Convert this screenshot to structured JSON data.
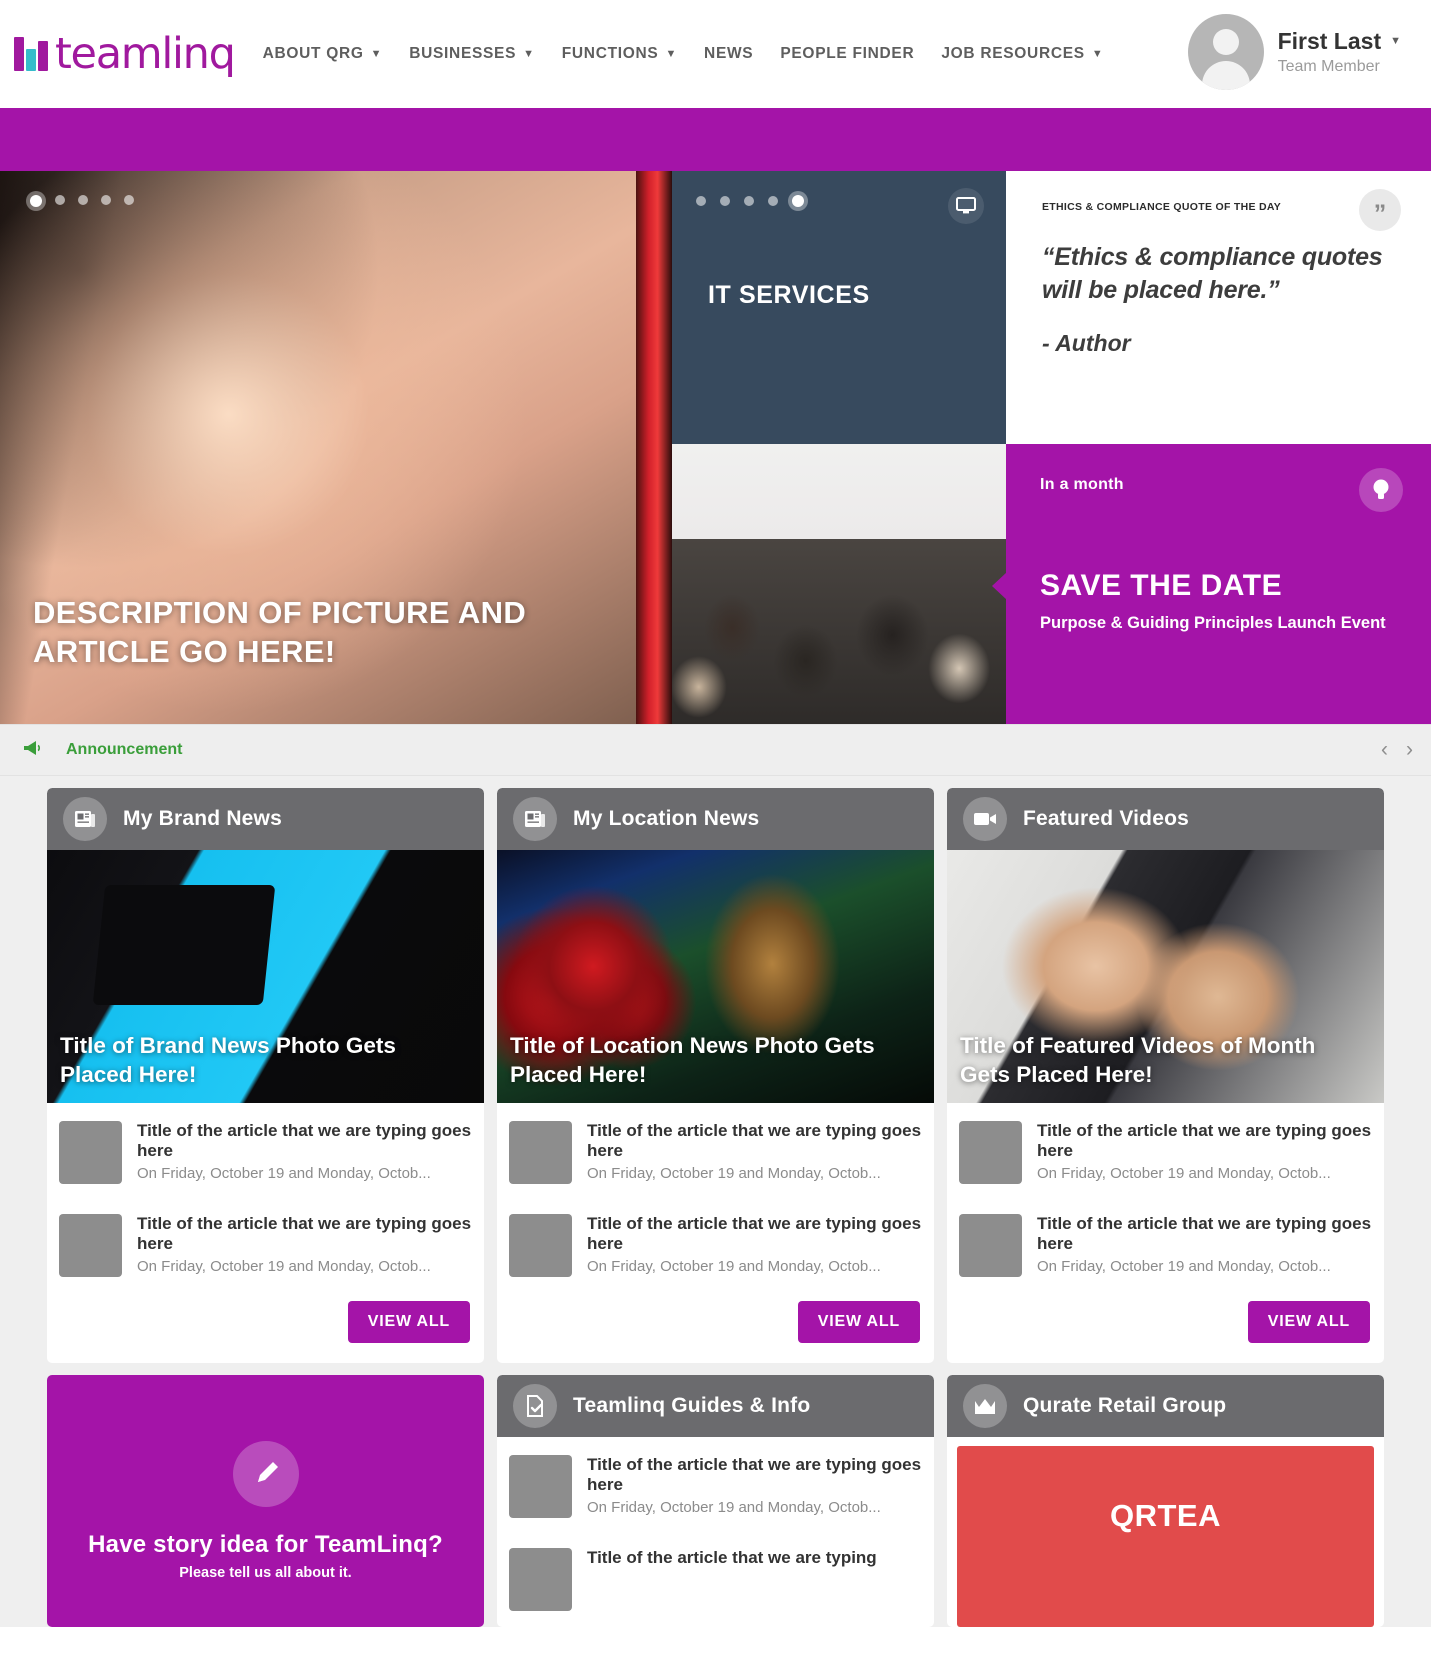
{
  "header": {
    "logo_text": "teamlinq",
    "nav": [
      {
        "label": "ABOUT QRG",
        "has_dropdown": true
      },
      {
        "label": "BUSINESSES",
        "has_dropdown": true
      },
      {
        "label": "FUNCTIONS",
        "has_dropdown": true
      },
      {
        "label": "NEWS",
        "has_dropdown": false
      },
      {
        "label": "PEOPLE FINDER",
        "has_dropdown": false
      },
      {
        "label": "JOB RESOURCES",
        "has_dropdown": true
      }
    ],
    "user": {
      "name": "First Last",
      "role": "Team Member",
      "caret": "⌵"
    }
  },
  "hero": {
    "main": {
      "caption": "DESCRIPTION OF PICTURE AND ARTICLE GO HERE!",
      "dots_total": 5,
      "dot_active": 1
    },
    "it_panel": {
      "title": "IT SERVICES",
      "dots_total": 5,
      "dot_active": 5,
      "icon": "monitor-icon"
    },
    "quote": {
      "kicker": "ETHICS & COMPLIANCE QUOTE OF THE DAY",
      "badge_glyph": "”",
      "text": "“Ethics & compliance quotes will be placed here.”",
      "author": "- Author"
    },
    "save_the_date": {
      "when": "In a month",
      "title": "SAVE THE DATE",
      "subtitle": "Purpose & Guiding Principles Launch Event",
      "icon": "lightbulb-icon",
      "color": "#a414a8"
    }
  },
  "announcement": {
    "label": "Announcement",
    "icon": "megaphone-icon",
    "color": "#3a9e3a",
    "prev": "‹",
    "next": "›"
  },
  "cards": [
    {
      "title": "My Brand News",
      "icon": "newspaper-icon",
      "hero_label": "Title of Brand News Photo Gets Placed Here!",
      "articles": [
        {
          "title": "Title of the article that we are typing goes here",
          "date": "On Friday, October 19 and Monday, Octob..."
        },
        {
          "title": "Title of the article that we are typing goes here",
          "date": "On Friday, October 19 and Monday, Octob..."
        }
      ],
      "view_all": "VIEW ALL"
    },
    {
      "title": "My Location News",
      "icon": "newspaper-icon",
      "hero_label": "Title of Location News Photo Gets Placed Here!",
      "articles": [
        {
          "title": "Title of the article that we are typing goes here",
          "date": "On Friday, October 19 and Monday, Octob..."
        },
        {
          "title": "Title of the article that we are typing goes here",
          "date": "On Friday, October 19 and Monday, Octob..."
        }
      ],
      "view_all": "VIEW ALL"
    },
    {
      "title": "Featured Videos",
      "icon": "video-camera-icon",
      "hero_label": "Title of Featured Videos of Month Gets Placed Here!",
      "articles": [
        {
          "title": "Title of the article that we are typing goes here",
          "date": "On Friday, October 19 and Monday, Octob..."
        },
        {
          "title": "Title of the article that we are typing goes here",
          "date": "On Friday, October 19 and Monday, Octob..."
        }
      ],
      "view_all": "VIEW ALL"
    }
  ],
  "bottom": {
    "story": {
      "title": "Have story idea for TeamLinq?",
      "subtitle": "Please tell us all about it.",
      "icon": "pen-nib-icon",
      "color": "#a414a8"
    },
    "guides": {
      "title": "Teamlinq Guides & Info",
      "icon": "document-check-icon",
      "articles": [
        {
          "title": "Title of the article that we are typing goes here",
          "date": "On Friday, October 19 and Monday, Octob..."
        },
        {
          "title": "Title of the article that we are typing",
          "date": ""
        }
      ]
    },
    "qurate": {
      "title": "Qurate Retail Group",
      "icon": "crown-icon",
      "ticker": "QRTEA",
      "ticker_color": "#e14b4b"
    }
  }
}
